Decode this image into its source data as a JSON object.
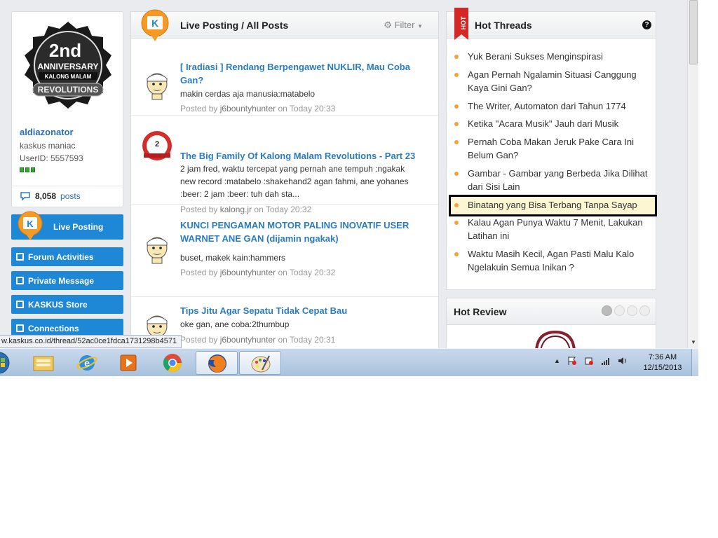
{
  "profile": {
    "badge_line1": "2nd",
    "badge_line2": "ANNIVERSARY",
    "badge_line3": "KALONG MALAM",
    "badge_line4": "REVOLUTIONS",
    "username": "aldiazonator",
    "title": "kaskus maniac",
    "userid": "UserID: 5557593",
    "posts_count": "8,058",
    "posts_label": "posts"
  },
  "nav": {
    "live_posting": "Live Posting",
    "forum_activities": "Forum Activities",
    "private_message": "Private Message",
    "kaskus_store": "KASKUS Store",
    "connections": "Connections"
  },
  "live": {
    "title": "Live Posting / All Posts",
    "filter": "Filter",
    "posts": [
      {
        "title": "[ Iradiasi ] Rendang Berpengawet NUKLIR, Mau Coba Gan?",
        "body": "makin cerdas aja manusia:matabelo",
        "by": "Posted by",
        "user": "j6bountyhunter",
        "time": "on Today 20:33"
      },
      {
        "title": "The Big Family Of Kalong Malam Revolutions - Part 23",
        "body": "2 jam fred, waktu tercepat yang pernah ane tempuh :ngakak new record :matabelo :shakehand2 agan fahmi, ane yohanes :beer: 2 jam :beer: tuh dah sta...",
        "by": "Posted by",
        "user": "kalong.jr",
        "time": "on Today 20:32"
      },
      {
        "title": "KUNCI PENGAMAN MOTOR PALING INOVATIF USER WARNET ANE GAN (dijamin ngakak)",
        "body": "buset, makek kain:hammers",
        "by": "Posted by",
        "user": "j6bountyhunter",
        "time": "on Today 20:32"
      },
      {
        "title": "Tips Jitu Agar Sepatu Tidak Cepat Bau",
        "body": "oke gan, ane coba:2thumbup",
        "by": "Posted by",
        "user": "j6bountyhunter",
        "time": "on Today 20:31"
      }
    ]
  },
  "hot": {
    "ribbon": "HOT",
    "title": "Hot Threads",
    "help": "?",
    "items": [
      "Yuk Berani Sukses Menginspirasi",
      "Agan Pernah Ngalamin Situasi Canggung Kaya Gini Gan?",
      "The Writer, Automaton dari Tahun 1774",
      "Ketika \"Acara Musik\" Jauh dari Musik",
      "Pernah Coba Makan Jeruk Pake Cara Ini Belum Gan?",
      "Gambar - Gambar yang Berbeda Jika Dilihat dari Sisi Lain",
      "Binatang yang Bisa Terbang Tanpa Sayap",
      "Kalau Agan Punya Waktu 7 Menit, Lakukan Latihan ini",
      "Waktu Masih Kecil, Agan Pasti Malu Kalo Ngelakuin Semua Inikan ?"
    ]
  },
  "review": {
    "title": "Hot Review",
    "active_slide": 1,
    "slide_count": 4
  },
  "status_url": "w.kaskus.co.id/thread/52ac0ce1fdca1731298b4571",
  "taskbar": {
    "time": "7:36 AM",
    "date": "12/15/2013"
  },
  "colors": {
    "accent_blue": "#1e88d6",
    "link_blue": "#2a7cc0",
    "hot_bullet": "#f2a33a",
    "highlight_border": "#000000"
  }
}
